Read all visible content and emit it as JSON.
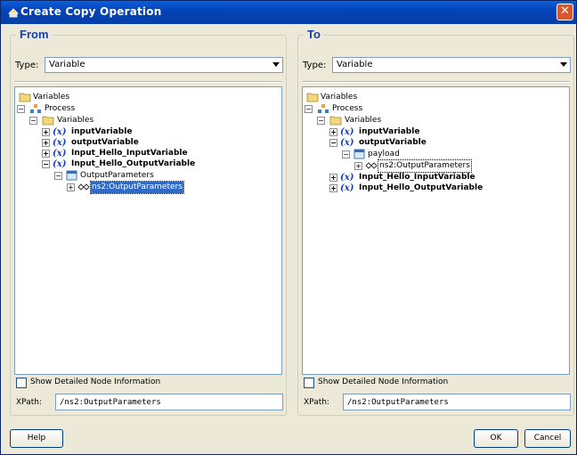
{
  "window": {
    "title": "Create Copy Operation"
  },
  "from": {
    "heading": "From",
    "type_label": "Type:",
    "type_value": "Variable",
    "tree": {
      "root": "Variables",
      "process": "Process",
      "variables": "Variables",
      "items": [
        "inputVariable",
        "outputVariable",
        "Input_Hello_InputVariable",
        "Input_Hello_OutputVariable"
      ],
      "x_glyph": "(x)",
      "output_parameters": "OutputParameters",
      "selected": "ns2:OutputParameters"
    },
    "show_detailed": "Show Detailed Node Information",
    "xpath_label": "XPath:",
    "xpath_value": "/ns2:OutputParameters"
  },
  "to": {
    "heading": "To",
    "type_label": "Type:",
    "type_value": "Variable",
    "tree": {
      "root": "Variables",
      "process": "Process",
      "variables": "Variables",
      "items": [
        "inputVariable",
        "outputVariable",
        "Input_Hello_InputVariable",
        "Input_Hello_OutputVariable"
      ],
      "x_glyph": "(x)",
      "payload": "payload",
      "selected": "ns2:OutputParameters"
    },
    "show_detailed": "Show Detailed Node Information",
    "xpath_label": "XPath:",
    "xpath_value": "/ns2:OutputParameters"
  },
  "buttons": {
    "help": "Help",
    "ok": "OK",
    "cancel": "Cancel"
  },
  "colors": {
    "title_bar": "#0443b8",
    "selection": "#316ac5",
    "heading": "#1a40a8"
  }
}
